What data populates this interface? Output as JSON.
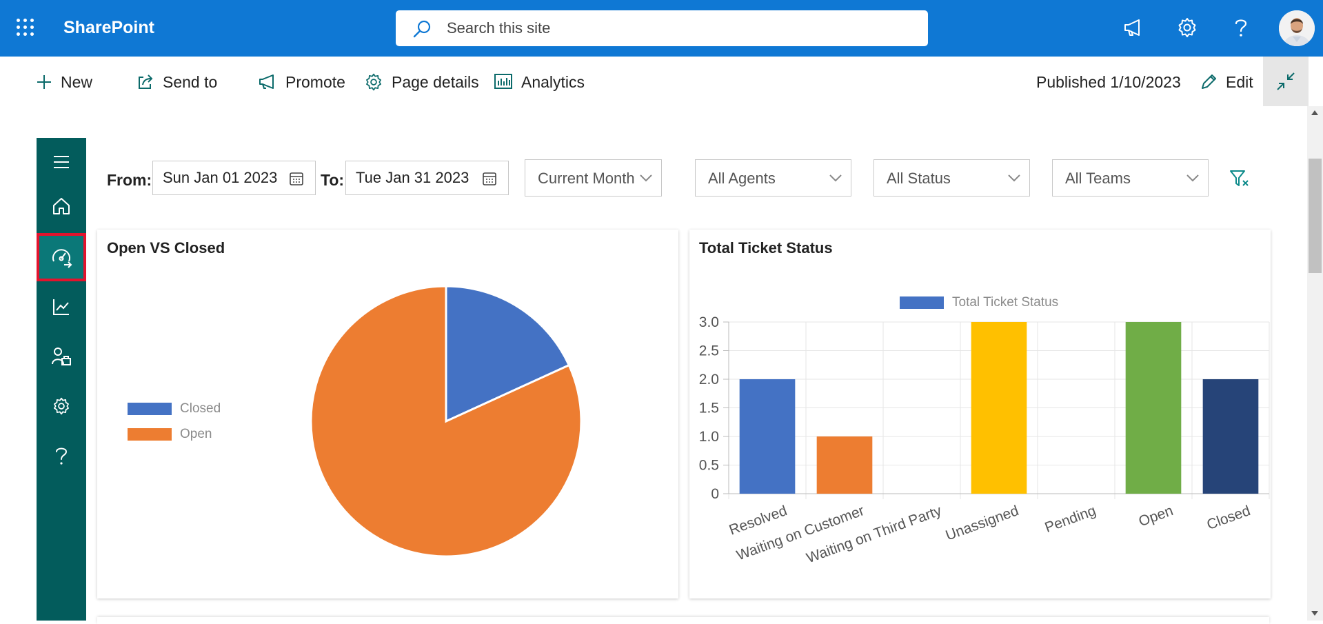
{
  "suite": {
    "brand": "SharePoint",
    "search_placeholder": "Search this site"
  },
  "command_bar": {
    "new_label": "New",
    "send_to_label": "Send to",
    "promote_label": "Promote",
    "page_details_label": "Page details",
    "analytics_label": "Analytics",
    "published": "Published 1/10/2023",
    "edit_label": "Edit"
  },
  "left_nav": {
    "items": [
      "menu-icon",
      "home-icon",
      "dashboard-icon",
      "analytics-icon",
      "agents-icon",
      "settings-icon",
      "help-icon"
    ],
    "active_item": "dashboard-icon"
  },
  "filters": {
    "from_label": "From:",
    "from_value": "Sun Jan 01 2023",
    "to_label": "To:",
    "to_value": "Tue Jan 31 2023",
    "period": "Current Month",
    "agents": "All Agents",
    "status": "All Status",
    "teams": "All Teams"
  },
  "colors": {
    "suitebar": "#0f78d4",
    "nav": "#035c5c",
    "accent": "#0b7878"
  },
  "chart_data": [
    {
      "type": "pie",
      "title": "Open VS Closed",
      "categories": [
        "Closed",
        "Open"
      ],
      "values": [
        1,
        4.5
      ],
      "colors": [
        "#4472c4",
        "#ed7d31"
      ],
      "legend_position": "left"
    },
    {
      "type": "bar",
      "title": "Total Ticket Status",
      "categories": [
        "Resolved",
        "Waiting on Customer",
        "Waiting on Third Party",
        "Unassigned",
        "Pending",
        "Open",
        "Closed"
      ],
      "series": [
        {
          "name": "Total Ticket Status",
          "values": [
            2,
            1,
            0,
            3,
            0,
            3,
            2
          ]
        }
      ],
      "bar_colors": [
        "#4472c4",
        "#ed7d31",
        "#a5a5a5",
        "#ffc000",
        "#5b9bd5",
        "#70ad47",
        "#264478"
      ],
      "y_ticks": [
        "0",
        "0.5",
        "1.0",
        "1.5",
        "2.0",
        "2.5",
        "3.0"
      ],
      "ylim": [
        0,
        3
      ],
      "grid": true,
      "legend_position": "top"
    }
  ]
}
